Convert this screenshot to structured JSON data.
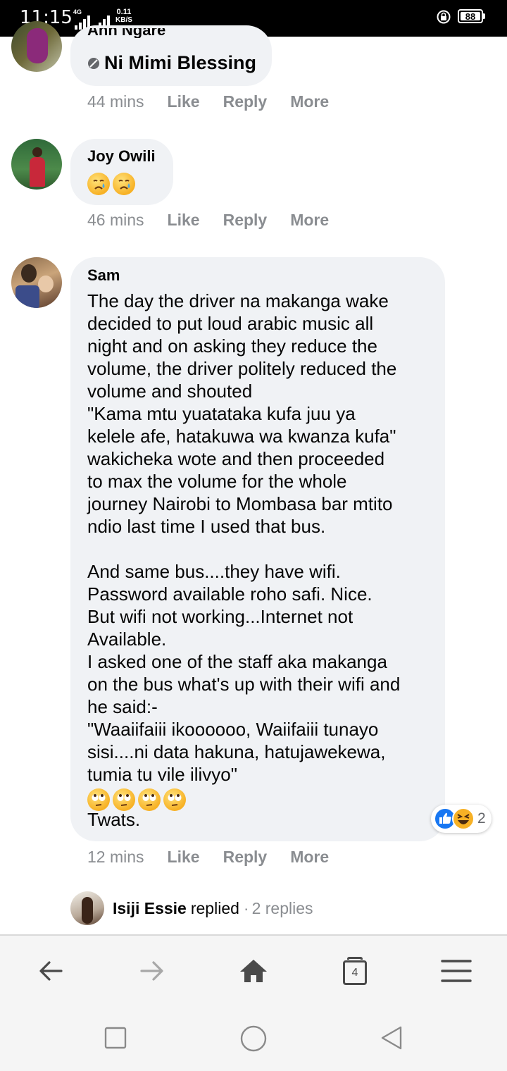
{
  "status_bar": {
    "time": "11:15",
    "network": "4G",
    "speed_value": "0.11",
    "speed_unit": "KB/S",
    "battery": "88"
  },
  "comments": [
    {
      "author": "Ann Ngare",
      "text": "Ni Mimi Blessing",
      "time": "44 mins",
      "actions": [
        "Like",
        "Reply",
        "More"
      ]
    },
    {
      "author": "Joy Owili",
      "emojis": [
        "crying-face",
        "crying-face"
      ],
      "time": "46 mins",
      "actions": [
        "Like",
        "Reply",
        "More"
      ]
    },
    {
      "author": "Sam",
      "text": "The day the driver na makanga wake\ndecided to put loud arabic music all\nnight and on asking they reduce the\nvolume, the driver politely reduced the\nvolume and shouted\n\"Kama mtu yuatataka kufa juu ya\nkelele afe, hatakuwa wa kwanza kufa\"\nwakicheka wote and then proceeded\nto max the volume for the whole\njourney Nairobi to Mombasa bar mtito\nndio last time I used that bus.\n\nAnd same bus....they have wifi.\nPassword available roho safi. Nice.\nBut wifi not working...Internet not\nAvailable.\nI asked one of the staff aka makanga\non the bus what's up with their wifi and\nhe said:-\n\"Waaiifaiii ikoooooo, Waiifaiii tunayo\nsisi....ni data hakuna, hatujawekewa,\ntumia tu vile ilivyo\"",
      "emojis": [
        "eye-roll-face",
        "eye-roll-face",
        "eye-roll-face",
        "eye-roll-face"
      ],
      "text_end": "Twats.",
      "reactions_count": "2",
      "time": "12 mins",
      "actions": [
        "Like",
        "Reply",
        "More"
      ]
    }
  ],
  "replies_row": {
    "name": "Isiji Essie",
    "verb": "replied",
    "separator": "·",
    "count": "2 replies"
  },
  "browser_nav": {
    "tab_count": "4"
  }
}
